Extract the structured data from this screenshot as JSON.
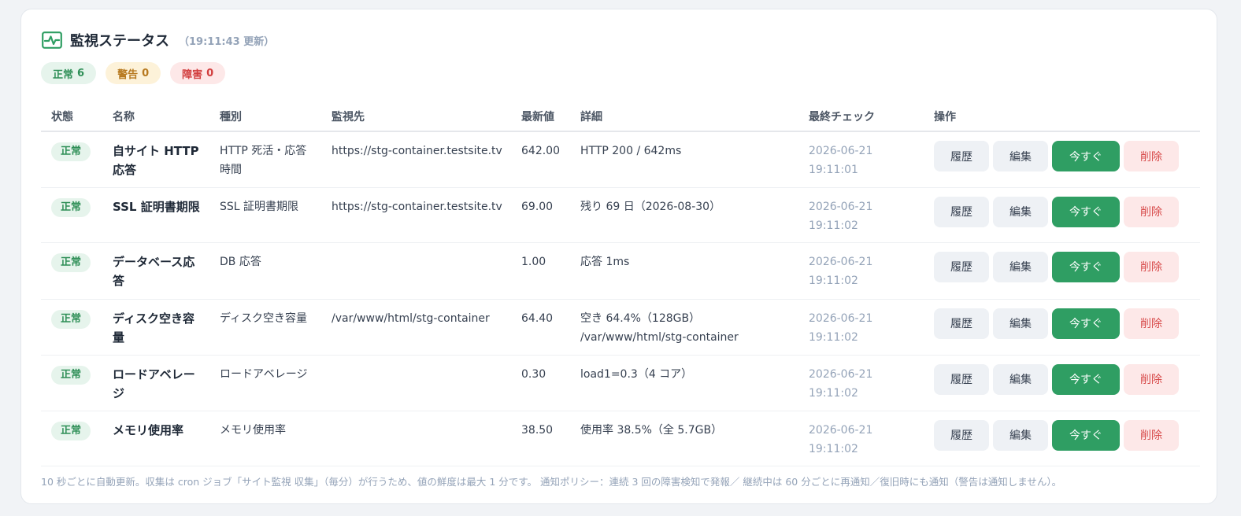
{
  "header": {
    "title": "監視ステータス",
    "updated": "（19:11:43 更新）",
    "icon": "activity-icon",
    "accent_color": "#2f9e63"
  },
  "summary": {
    "ok": {
      "label": "正常",
      "count": "6",
      "color": "#2f8f57"
    },
    "warn": {
      "label": "警告",
      "count": "0",
      "color": "#b7791f"
    },
    "err": {
      "label": "障害",
      "count": "0",
      "color": "#d23f3f"
    }
  },
  "columns": {
    "status": "状態",
    "name": "名称",
    "type": "種別",
    "target": "監視先",
    "latest": "最新値",
    "detail": "詳細",
    "last_check": "最終チェック",
    "ops": "操作"
  },
  "actions": {
    "history": "履歴",
    "edit": "編集",
    "run_now": "今すぐ",
    "delete": "削除"
  },
  "rows": [
    {
      "status": "正常",
      "name": "自サイト HTTP 応答",
      "type": "HTTP 死活・応答時間",
      "target": "https://stg-container.testsite.tv",
      "latest": "642.00",
      "detail": "HTTP 200 / 642ms",
      "last_check": "2026-06-21 19:11:01"
    },
    {
      "status": "正常",
      "name": "SSL 証明書期限",
      "type": "SSL 証明書期限",
      "target": "https://stg-container.testsite.tv",
      "latest": "69.00",
      "detail": "残り 69 日（2026-08-30）",
      "last_check": "2026-06-21 19:11:02"
    },
    {
      "status": "正常",
      "name": "データベース応答",
      "type": "DB 応答",
      "target": "",
      "latest": "1.00",
      "detail": "応答 1ms",
      "last_check": "2026-06-21 19:11:02"
    },
    {
      "status": "正常",
      "name": "ディスク空き容量",
      "type": "ディスク空き容量",
      "target": "/var/www/html/stg-container",
      "latest": "64.40",
      "detail": "空き 64.4%（128GB） /var/www/html/stg-container",
      "last_check": "2026-06-21 19:11:02"
    },
    {
      "status": "正常",
      "name": "ロードアベレージ",
      "type": "ロードアベレージ",
      "target": "",
      "latest": "0.30",
      "detail": "load1=0.3（4 コア）",
      "last_check": "2026-06-21 19:11:02"
    },
    {
      "status": "正常",
      "name": "メモリ使用率",
      "type": "メモリ使用率",
      "target": "",
      "latest": "38.50",
      "detail": "使用率 38.5%（全 5.7GB）",
      "last_check": "2026-06-21 19:11:02"
    }
  ],
  "footer": "10 秒ごとに自動更新。収集は cron ジョブ「サイト監視 収集」（毎分）が行うため、値の鮮度は最大 1 分です。 通知ポリシー：連続 3 回の障害検知で発報／ 継続中は 60 分ごとに再通知／復旧時にも通知（警告は通知しません）。"
}
